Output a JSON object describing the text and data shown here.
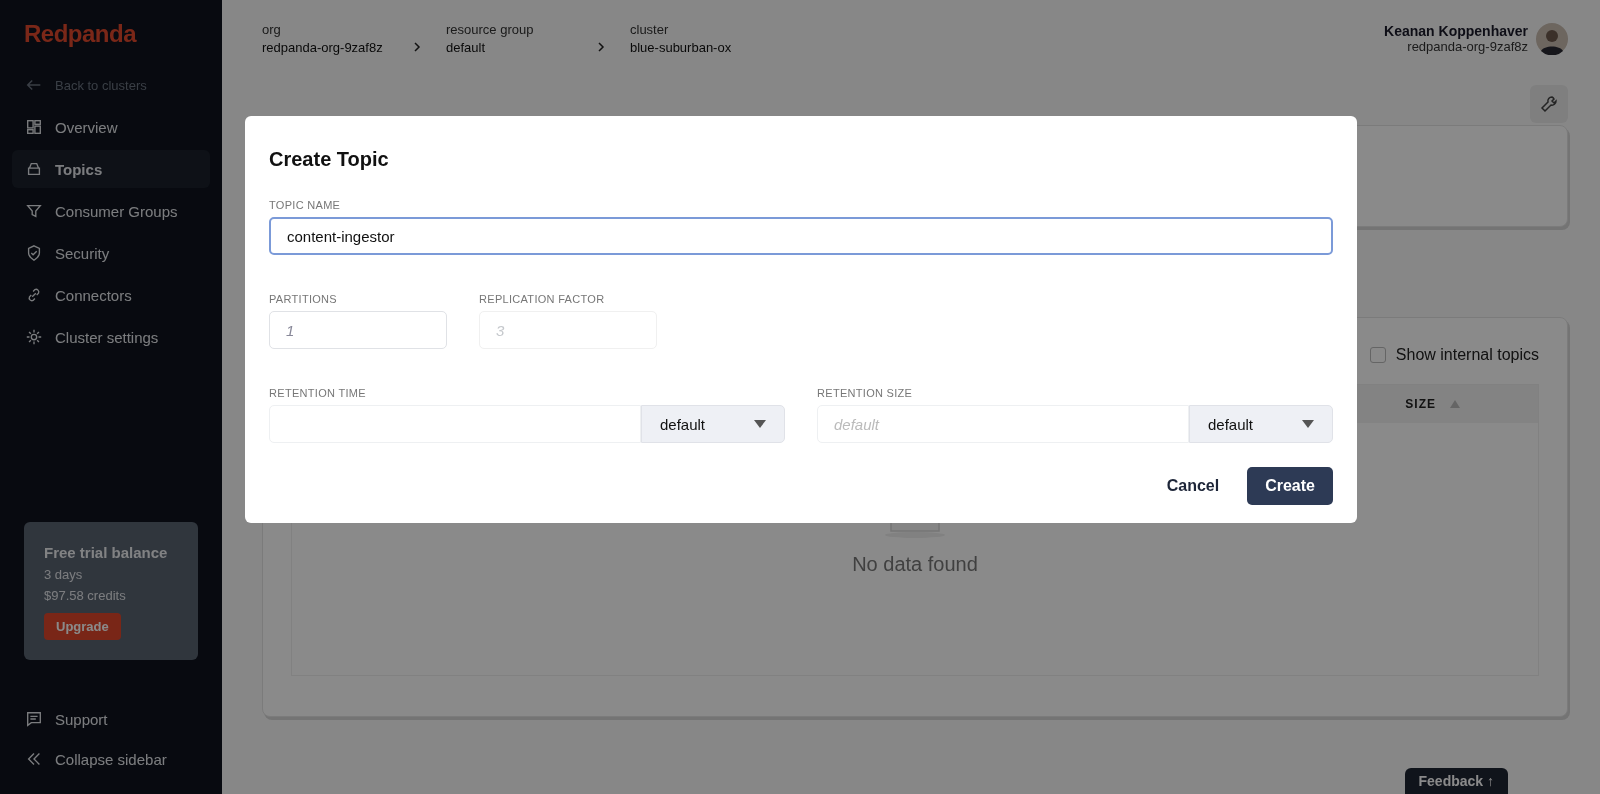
{
  "sidebar": {
    "logo": "Redpanda",
    "back_link": "Back to clusters",
    "items": [
      {
        "label": "Overview",
        "selected": false
      },
      {
        "label": "Topics",
        "selected": true
      },
      {
        "label": "Consumer Groups",
        "selected": false
      },
      {
        "label": "Security",
        "selected": false
      },
      {
        "label": "Connectors",
        "selected": false
      },
      {
        "label": "Cluster settings",
        "selected": false
      }
    ],
    "trial": {
      "title": "Free trial balance",
      "days": "3 days",
      "credits": "$97.58 credits",
      "button": "Upgrade"
    },
    "footer_items": [
      {
        "label": "Support"
      },
      {
        "label": "Collapse sidebar"
      }
    ]
  },
  "breadcrumbs": [
    {
      "label": "org",
      "value": "redpanda-org-9zaf8z"
    },
    {
      "label": "resource group",
      "value": "default"
    },
    {
      "label": "cluster",
      "value": "blue-suburban-ox"
    }
  ],
  "user": {
    "name": "Keanan Koppenhaver",
    "org": "redpanda-org-9zaf8z"
  },
  "topics_panel": {
    "show_internal": {
      "label": "Show internal topics",
      "checked": false
    },
    "column": "SIZE",
    "empty": "No data found"
  },
  "feedback": "Feedback ↑",
  "dialog": {
    "title": "Create Topic",
    "topic_name": {
      "label": "TOPIC NAME",
      "value": "content-ingestor"
    },
    "partitions": {
      "label": "PARTITIONS",
      "placeholder": "1",
      "disabled": false
    },
    "replication": {
      "label": "REPLICATION FACTOR",
      "placeholder": "3",
      "disabled": true
    },
    "retention_time": {
      "label": "RETENTION TIME",
      "unit": "default"
    },
    "retention_size": {
      "label": "RETENTION SIZE",
      "placeholder": "default",
      "unit": "default"
    },
    "buttons": {
      "cancel": "Cancel",
      "create": "Create"
    }
  }
}
